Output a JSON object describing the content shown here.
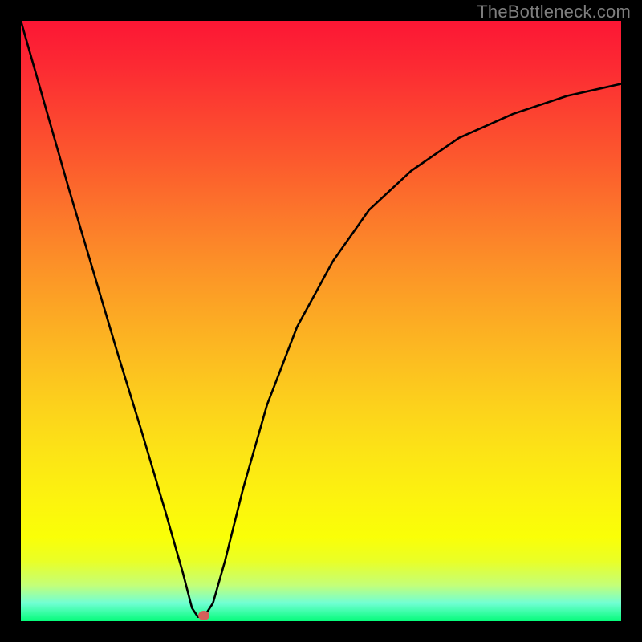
{
  "watermark": "TheBottleneck.com",
  "colors": {
    "frame_border": "#000000",
    "curve_stroke": "#000000",
    "marker_fill": "#d4605a",
    "gradient_top": "#fc1634",
    "gradient_bottom": "#05fc7a"
  },
  "chart_data": {
    "type": "line",
    "title": "",
    "xlabel": "",
    "ylabel": "",
    "xlim": [
      0,
      100
    ],
    "ylim": [
      0,
      100
    ],
    "note": "x and y given as percentages of the plot area; y=0 is bottom (green), y=100 is top (red). Curve shows a sharp V-shaped dip around x≈30 then a slow rise/level toward the right.",
    "series": [
      {
        "name": "bottleneck-curve",
        "x": [
          0,
          4,
          8,
          12,
          16,
          20,
          24,
          27,
          28.5,
          29.5,
          30.5,
          32,
          34,
          37,
          41,
          46,
          52,
          58,
          65,
          73,
          82,
          91,
          100
        ],
        "y": [
          100,
          86,
          72,
          58.5,
          45,
          32,
          18.5,
          8,
          2.2,
          0.7,
          0.7,
          3,
          10,
          22,
          36,
          49,
          60,
          68.5,
          75,
          80.5,
          84.5,
          87.5,
          89.5
        ]
      }
    ],
    "marker": {
      "x": 30.5,
      "y": 0.9
    }
  }
}
